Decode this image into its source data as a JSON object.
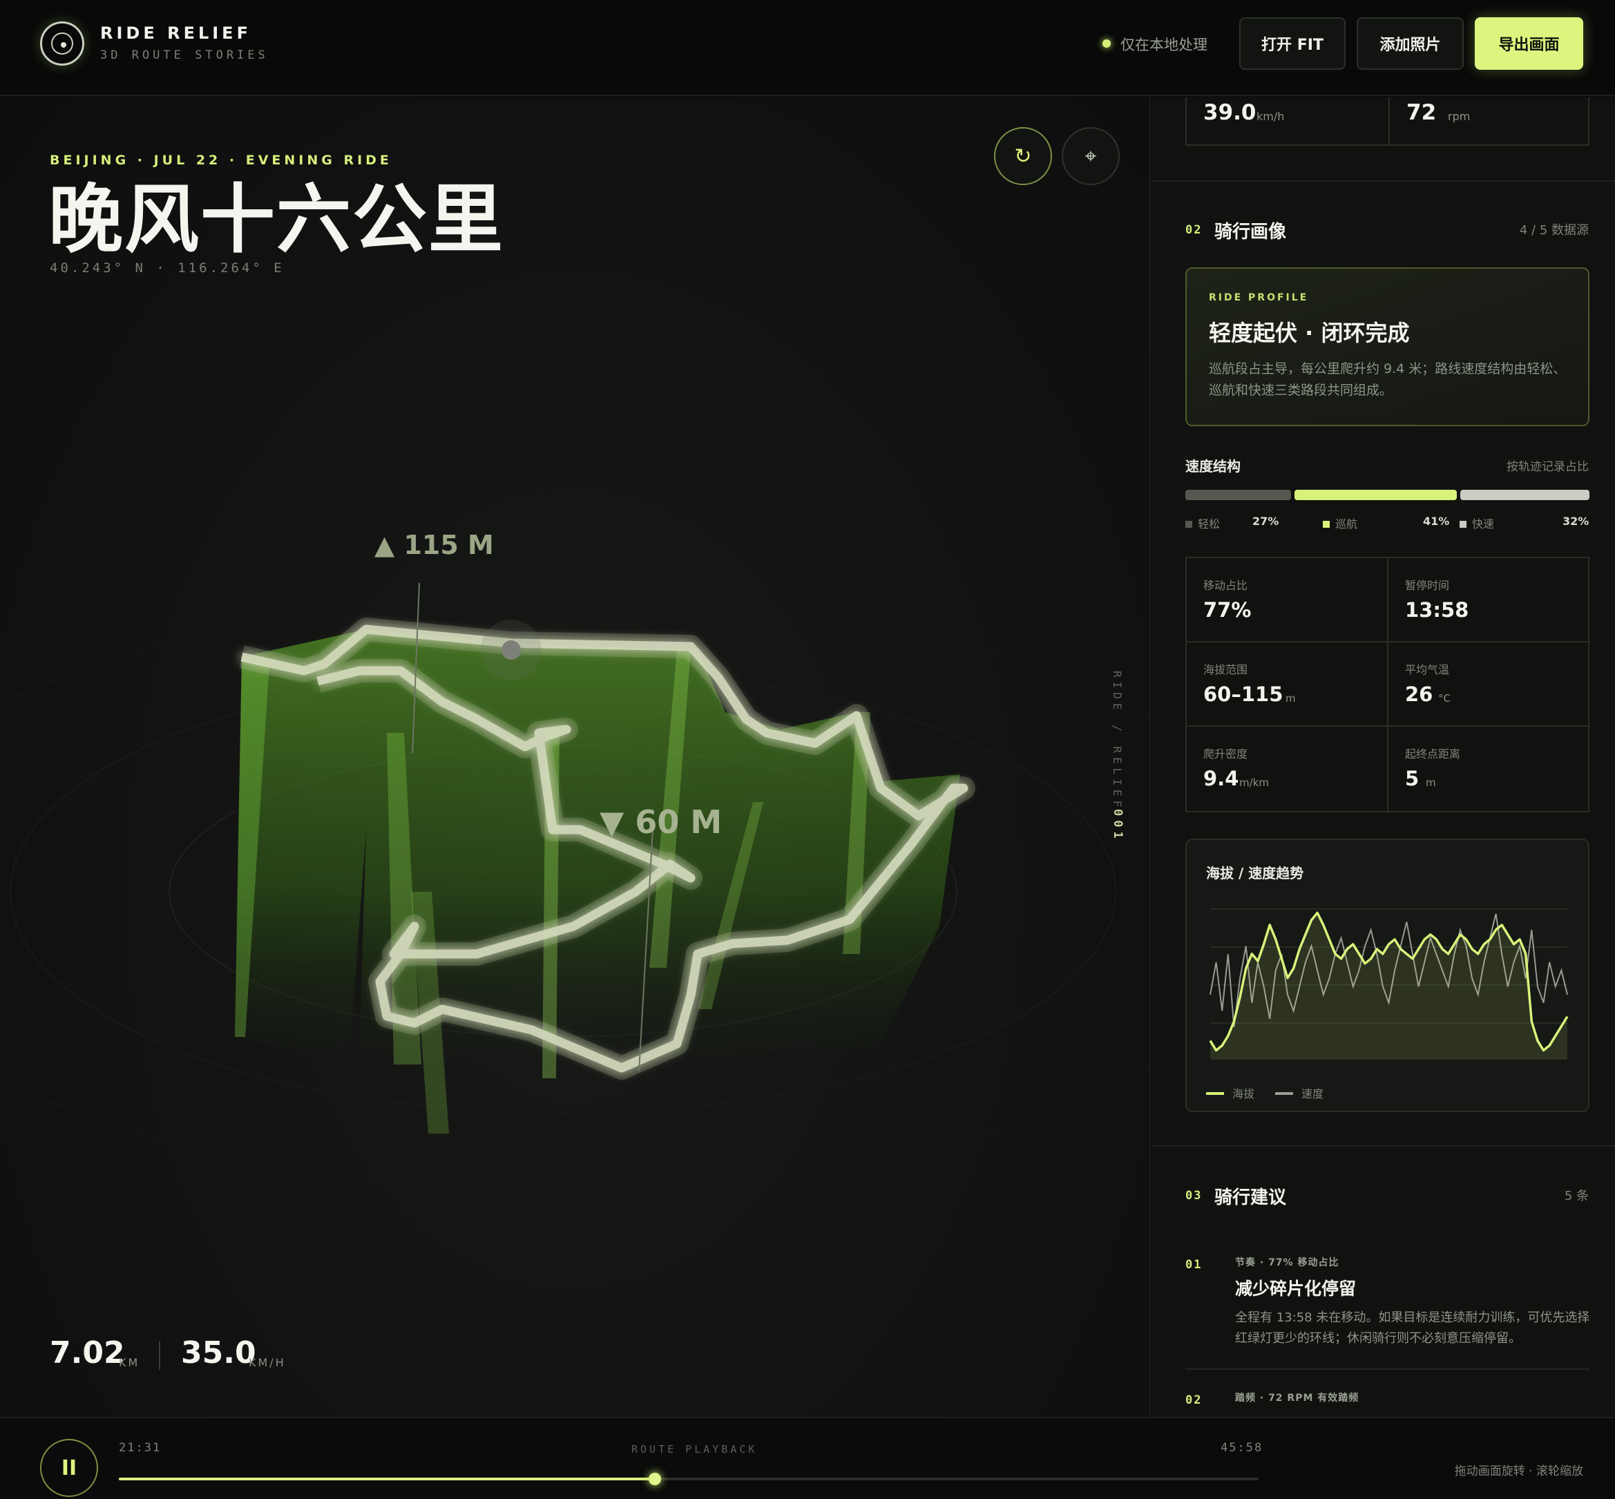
{
  "header": {
    "brand_title": "RIDE RELIEF",
    "brand_subtitle": "3D ROUTE STORIES",
    "local_status": "仅在本地处理",
    "buttons": {
      "open_fit": "打开 FIT",
      "add_photo": "添加照片",
      "export": "导出画面"
    }
  },
  "map": {
    "kicker": "BEIJING · JUL 22 · EVENING RIDE",
    "title": "晚风十六公里",
    "coords": "40.243° N · 116.264° E",
    "elev_high": "▲ 115 M",
    "elev_low": "▼ 60 M",
    "vertical_label": "RIDE / RELIEF",
    "vertical_num": "001",
    "distance": "7.02",
    "distance_unit": "KM",
    "speed": "35.0",
    "speed_unit": "KM/H",
    "refresh_icon": "↻",
    "target_icon": "⌖"
  },
  "sidebar": {
    "top_stats": [
      {
        "value": "39.0",
        "unit": "km/h"
      },
      {
        "value": "72",
        "unit": "rpm"
      }
    ],
    "profile_section": {
      "num": "02",
      "title": "骑行画像",
      "right": "4 / 5 数据源"
    },
    "profile_card": {
      "kicker": "RIDE PROFILE",
      "title": "轻度起伏 · 闭环完成",
      "desc": "巡航段占主导，每公里爬升约 9.4 米；路线速度结构由轻松、巡航和快速三类路段共同组成。"
    },
    "speed_structure": {
      "label": "速度结构",
      "right": "按轨迹记录占比",
      "segments": [
        {
          "name": "轻松",
          "pct": "27%",
          "value": 27,
          "color": "#55584f"
        },
        {
          "name": "巡航",
          "pct": "41%",
          "value": 41,
          "color": "#d8f27a"
        },
        {
          "name": "快速",
          "pct": "32%",
          "value": 32,
          "color": "#c9ccc2"
        }
      ]
    },
    "metrics": [
      {
        "label": "移动占比",
        "value": "77%",
        "unit": ""
      },
      {
        "label": "暂停时间",
        "value": "13:58",
        "unit": ""
      },
      {
        "label": "海拔范围",
        "value": "60–115",
        "unit": "m"
      },
      {
        "label": "平均气温",
        "value": "26",
        "unit": "°C"
      },
      {
        "label": "爬升密度",
        "value": "9.4",
        "unit": "m/km"
      },
      {
        "label": "起终点距离",
        "value": "5",
        "unit": "m"
      }
    ],
    "trend": {
      "title": "海拔 / 速度趋势",
      "legend_elev": "海拔",
      "legend_speed": "速度"
    },
    "advice_section": {
      "num": "03",
      "title": "骑行建议",
      "right": "5 条"
    },
    "advice": [
      {
        "num": "01",
        "kicker": "节奏 · 77% 移动占比",
        "title": "减少碎片化停留",
        "desc": "全程有 13:58 未在移动。如果目标是连续耐力训练，可优先选择红绿灯更少的环线；休闲骑行则不必刻意压缩停留。"
      },
      {
        "num": "02",
        "kicker": "踏频 · 72 RPM 有效踏频"
      }
    ]
  },
  "footer": {
    "play_icon": "II",
    "time_start": "21:31",
    "time_end": "45:58",
    "label": "ROUTE PLAYBACK",
    "progress": 0.47,
    "hint": "拖动画面旋转 · 滚轮缩放"
  },
  "chart_data": {
    "type": "line",
    "title": "海拔 / 速度趋势",
    "series": [
      {
        "name": "海拔",
        "color": "#d8f27a",
        "values": [
          62,
          58,
          60,
          64,
          70,
          80,
          92,
          98,
          95,
          102,
          110,
          104,
          96,
          88,
          92,
          100,
          106,
          112,
          115,
          110,
          104,
          98,
          96,
          100,
          102,
          98,
          94,
          96,
          100,
          98,
          102,
          104,
          100,
          98,
          96,
          100,
          104,
          106,
          104,
          100,
          98,
          102,
          106,
          104,
          100,
          98,
          102,
          104,
          108,
          110,
          106,
          102,
          104,
          98,
          70,
          62,
          58,
          60,
          64,
          68,
          72
        ]
      },
      {
        "name": "速度",
        "color": "#b9bcb2",
        "values": [
          28,
          36,
          24,
          38,
          20,
          32,
          40,
          26,
          36,
          30,
          22,
          34,
          38,
          28,
          24,
          30,
          36,
          40,
          34,
          28,
          32,
          38,
          42,
          36,
          30,
          34,
          40,
          44,
          38,
          30,
          26,
          34,
          40,
          46,
          38,
          30,
          36,
          42,
          38,
          34,
          30,
          38,
          44,
          40,
          32,
          28,
          36,
          42,
          48,
          38,
          30,
          36,
          40,
          32,
          44,
          30,
          26,
          36,
          30,
          34,
          28
        ]
      }
    ],
    "grid": true
  }
}
